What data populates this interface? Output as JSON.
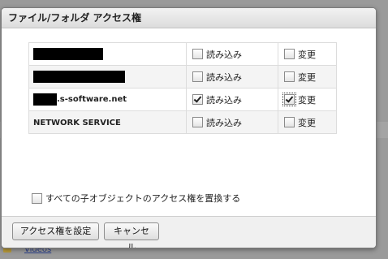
{
  "dialog": {
    "title": "ファイル/フォルダ アクセス権",
    "permissions": [
      {
        "name": "",
        "redacted": true,
        "host_suffix": "",
        "read_label": "読み込み",
        "read_checked": false,
        "change_label": "変更",
        "change_checked": false
      },
      {
        "name": "",
        "redacted": true,
        "host_suffix": "",
        "read_label": "読み込み",
        "read_checked": false,
        "change_label": "変更",
        "change_checked": false
      },
      {
        "name": "",
        "redacted": true,
        "host_suffix": ".s-software.net",
        "read_label": "読み込み",
        "read_checked": true,
        "change_label": "変更",
        "change_checked": true
      },
      {
        "name": "NETWORK SERVICE",
        "redacted": false,
        "host_suffix": "",
        "read_label": "読み込み",
        "read_checked": false,
        "change_label": "変更",
        "change_checked": false
      }
    ],
    "replace_label": "すべての子オブジェクトのアクセス権を置換する",
    "replace_checked": false,
    "buttons": {
      "set": "アクセス権を設定",
      "cancel": "キャンセル"
    }
  },
  "background": {
    "videos_link": "Videos"
  }
}
